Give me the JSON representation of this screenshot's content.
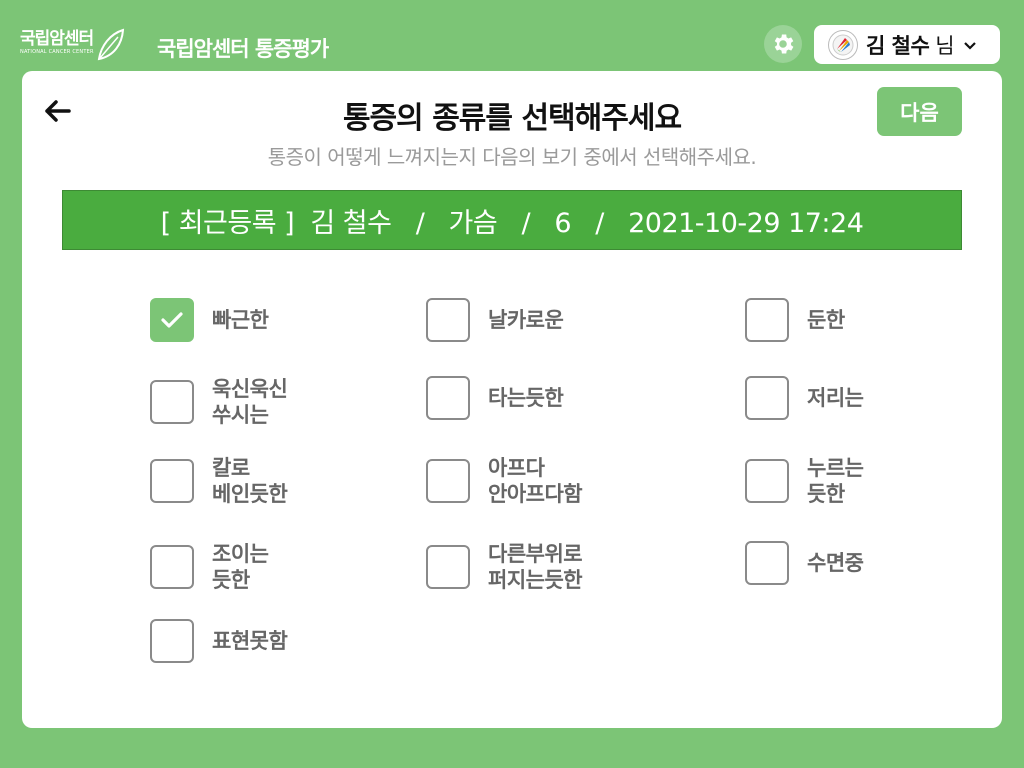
{
  "header": {
    "logo_main": "국립암센터",
    "logo_sub": "NATIONAL CANCER CENTER",
    "app_title": "국립암센터 통증평가",
    "user_name": "김 철수",
    "user_suffix": "님"
  },
  "page": {
    "title": "통증의 종류를 선택해주세요",
    "subtitle": "통증이 어떻게 느껴지는지 다음의 보기 중에서 선택해주세요.",
    "next_label": "다음",
    "banner": "[ 최근등록 ]  김 철수   /   가슴   /   6   /   2021-10-29 17:24"
  },
  "options": [
    {
      "label": "빠근한",
      "checked": true
    },
    {
      "label": "날카로운",
      "checked": false
    },
    {
      "label": "둔한",
      "checked": false
    },
    {
      "label": "욱신욱신\n쑤시는",
      "checked": false
    },
    {
      "label": "타는듯한",
      "checked": false
    },
    {
      "label": "저리는",
      "checked": false
    },
    {
      "label": "칼로\n베인듯한",
      "checked": false
    },
    {
      "label": "아프다\n안아프다함",
      "checked": false
    },
    {
      "label": "누르는\n듯한",
      "checked": false
    },
    {
      "label": "조이는\n듯한",
      "checked": false
    },
    {
      "label": "다른부위로\n퍼지는듯한",
      "checked": false
    },
    {
      "label": "수면중",
      "checked": false
    },
    {
      "label": "표현못함",
      "checked": false
    }
  ],
  "colors": {
    "background": "#7cc576",
    "banner": "#4aac3f",
    "checked": "#7cc576"
  }
}
